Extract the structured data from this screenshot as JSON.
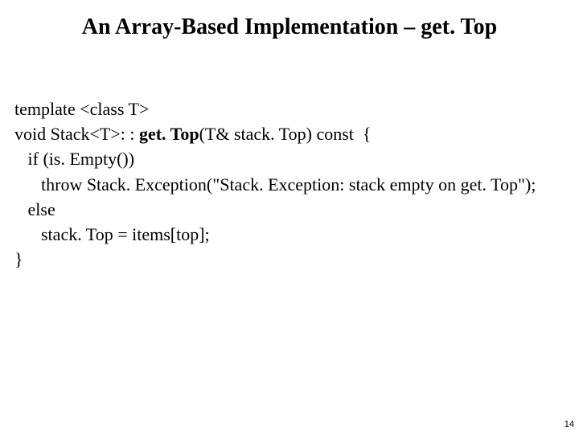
{
  "slide": {
    "title": "An Array-Based Implementation – get. Top",
    "page_number": "14",
    "code": {
      "l1": "template <class T>",
      "l2a": "void Stack<T>: : ",
      "l2b": "get. Top",
      "l2c": "(T& stack. Top) const  {",
      "l3": "   if (is. Empty())",
      "l4": "      throw Stack. Exception(\"Stack. Exception: stack empty on get. Top\");",
      "l5": "   else",
      "l6": "      stack. Top = items[top];",
      "l7": "}"
    }
  }
}
